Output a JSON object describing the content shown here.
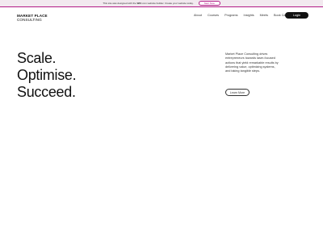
{
  "banner": {
    "text_before": "This site was designed with the ",
    "brand": "WiX",
    "text_after": ".com website builder. Create your website today.",
    "button_label": "Start Now"
  },
  "header": {
    "logo_line1": "MARKET PLACE",
    "logo_line2": "CONSULTING",
    "nav": [
      "About",
      "Courses",
      "Programs",
      "Insights",
      "Meets",
      "Book Call"
    ],
    "login_label": "Login"
  },
  "hero": {
    "lines": [
      "Scale.",
      "Optimise.",
      "Succeed."
    ],
    "description": "Market Place Consulting drives entrepreneurs towards laser-focused actions that yield remarkable results by delivering value, optimizing systems, and taking tangible steps.",
    "cta_label": "Learn More"
  },
  "colors": {
    "banner_accent": "#b21a86",
    "banner_bg": "#f2e9ef",
    "login_bg": "#111111"
  }
}
